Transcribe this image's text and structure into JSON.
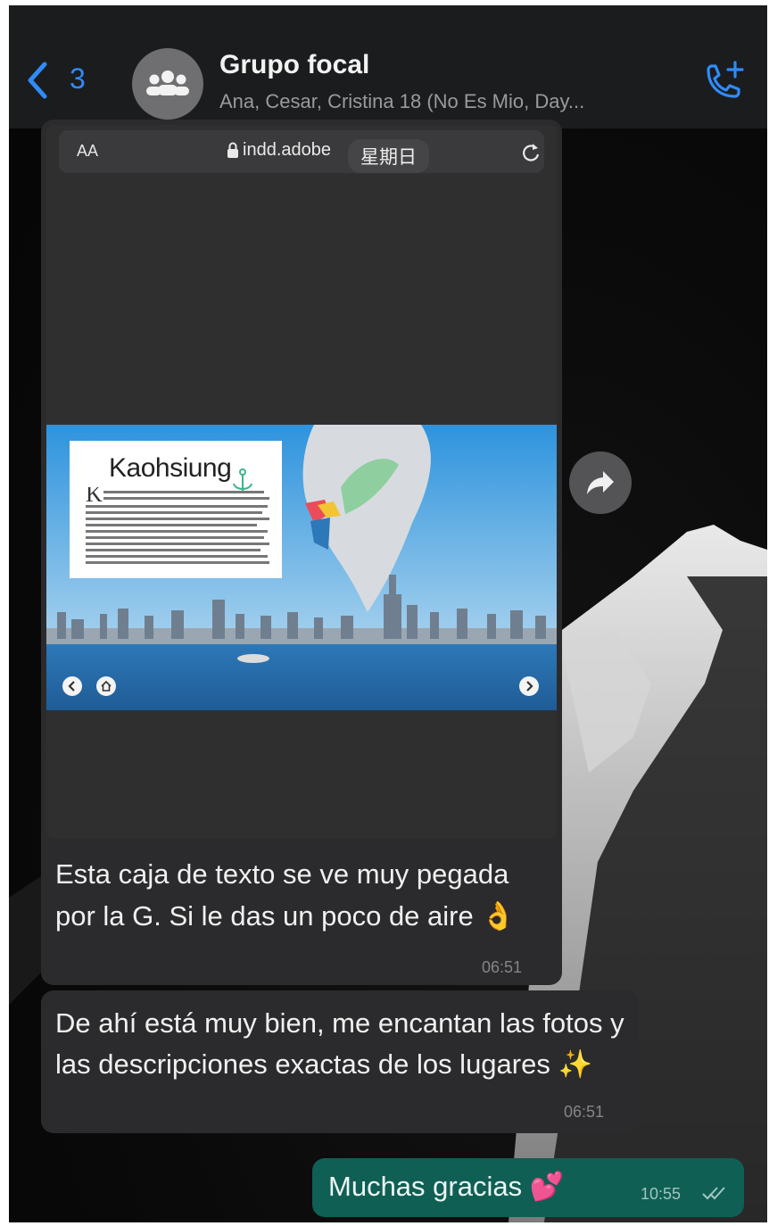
{
  "header": {
    "back_count": "3",
    "title": "Grupo focal",
    "members": "Ana, Cesar, Cristina 18 (No Es Mio, Day...",
    "accent": "#2f8cf7"
  },
  "screenshot": {
    "text_size_label": "AA",
    "url": "indd.adobe",
    "date_chip": "星期日",
    "slide_title": "Kaohsiung",
    "slide_body": "Kaohsiung es una enorme ciudad portuaria al sur de Taiwán. Tiene muchos lascaros como la Tuntex Sky Tower, de 348 m de altura, y es conocida por su diversidad de parques. El punto central es el río Love, con senderos peatonales y cafés en las orillas y paseos en bote en el agua. Las alternativas comerciales varían desde los centros comerciales lujosos hasta los mercados nocturnos de Liuhe y"
  },
  "messages": [
    {
      "text": "Esta caja de texto se ve muy pegada por la G. Si le das un poco de aire 👌",
      "time": "06:51"
    },
    {
      "text": "De ahí está muy bien, me encantan las fotos y las descripciones exactas de los lugares ✨",
      "time": "06:51"
    },
    {
      "text": "Muchas gracias 💕",
      "time": "10:55"
    }
  ],
  "colors": {
    "incoming_bubble": "#2b2b2d",
    "outgoing_bubble": "#0f5f54",
    "header_bg": "#1b1c1e"
  }
}
